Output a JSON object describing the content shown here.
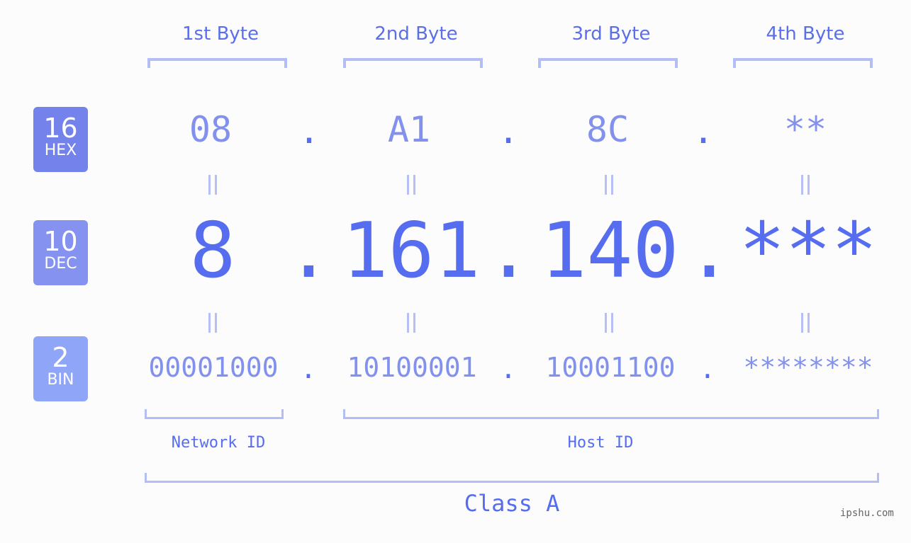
{
  "byte_headers": [
    "1st Byte",
    "2nd Byte",
    "3rd Byte",
    "4th Byte"
  ],
  "badges": [
    {
      "number": "16",
      "label": "HEX",
      "color": "#7482eb"
    },
    {
      "number": "10",
      "label": "DEC",
      "color": "#8592f0"
    },
    {
      "number": "2",
      "label": "BIN",
      "color": "#8fa6f8"
    }
  ],
  "hex": [
    "08",
    "A1",
    "8C",
    "**"
  ],
  "dec": [
    "8",
    "161",
    "140",
    "***"
  ],
  "bin": [
    "00001000",
    "10100001",
    "10001100",
    "********"
  ],
  "separator": ".",
  "network_id_label": "Network ID",
  "host_id_label": "Host ID",
  "class_label": "Class A",
  "watermark": "ipshu.com",
  "colors": {
    "accent": "#566df0",
    "light_value": "#8290ee",
    "bracket": "#b3bdf6",
    "background": "#fbfcfb"
  }
}
